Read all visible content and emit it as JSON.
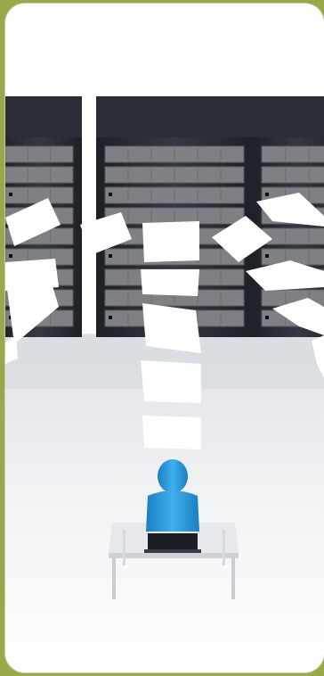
{
  "scene": {
    "subject": "person-at-laptop",
    "palette": {
      "frame": "#9aa84a",
      "card": "#ffffff",
      "floor": "#eef0f2",
      "rack": "#2a2d36",
      "rack_panel": "#7f8084",
      "person": "#2f9fde",
      "paper": "#ffffff"
    }
  }
}
